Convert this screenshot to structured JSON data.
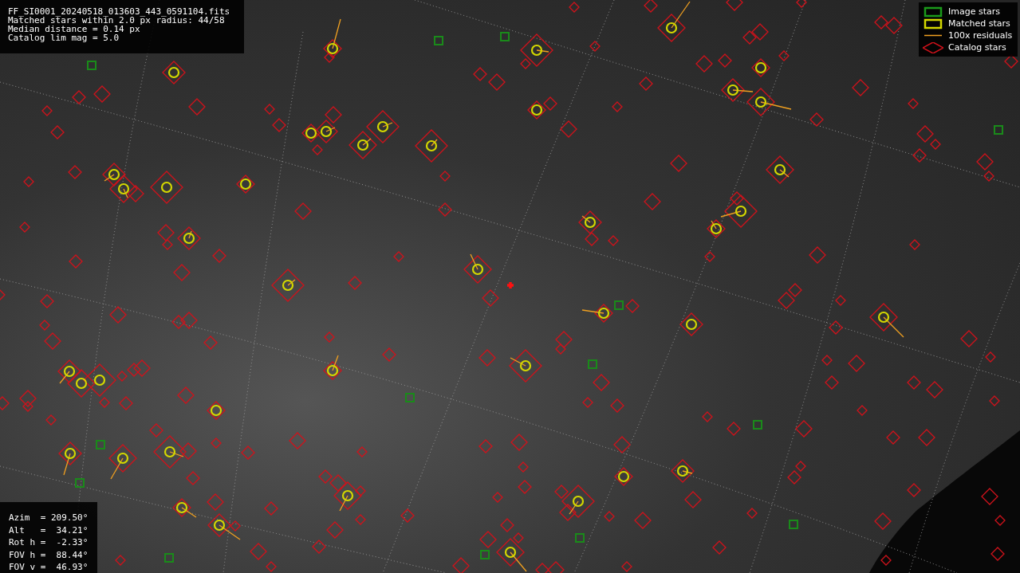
{
  "info_panel": {
    "lines": [
      "FF_SI0001_20240518_013603_443_0591104.fits",
      "Matched stars within 2.0 px radius: 44/58",
      "Median distance = 0.14 px",
      "Catalog lim mag = 5.0"
    ]
  },
  "legend": [
    {
      "kind": "image",
      "label": "Image stars"
    },
    {
      "kind": "matched",
      "label": "Matched stars"
    },
    {
      "kind": "residual",
      "label": "100x residuals"
    },
    {
      "kind": "catalog",
      "label": "Catalog stars"
    }
  ],
  "pointing_panel": {
    "lines": [
      "Azim  = 209.50°",
      "Alt   =  34.21°",
      "Rot h =  -2.33°",
      "FOV h =  88.44°",
      "FOV v =  46.93°"
    ]
  }
}
